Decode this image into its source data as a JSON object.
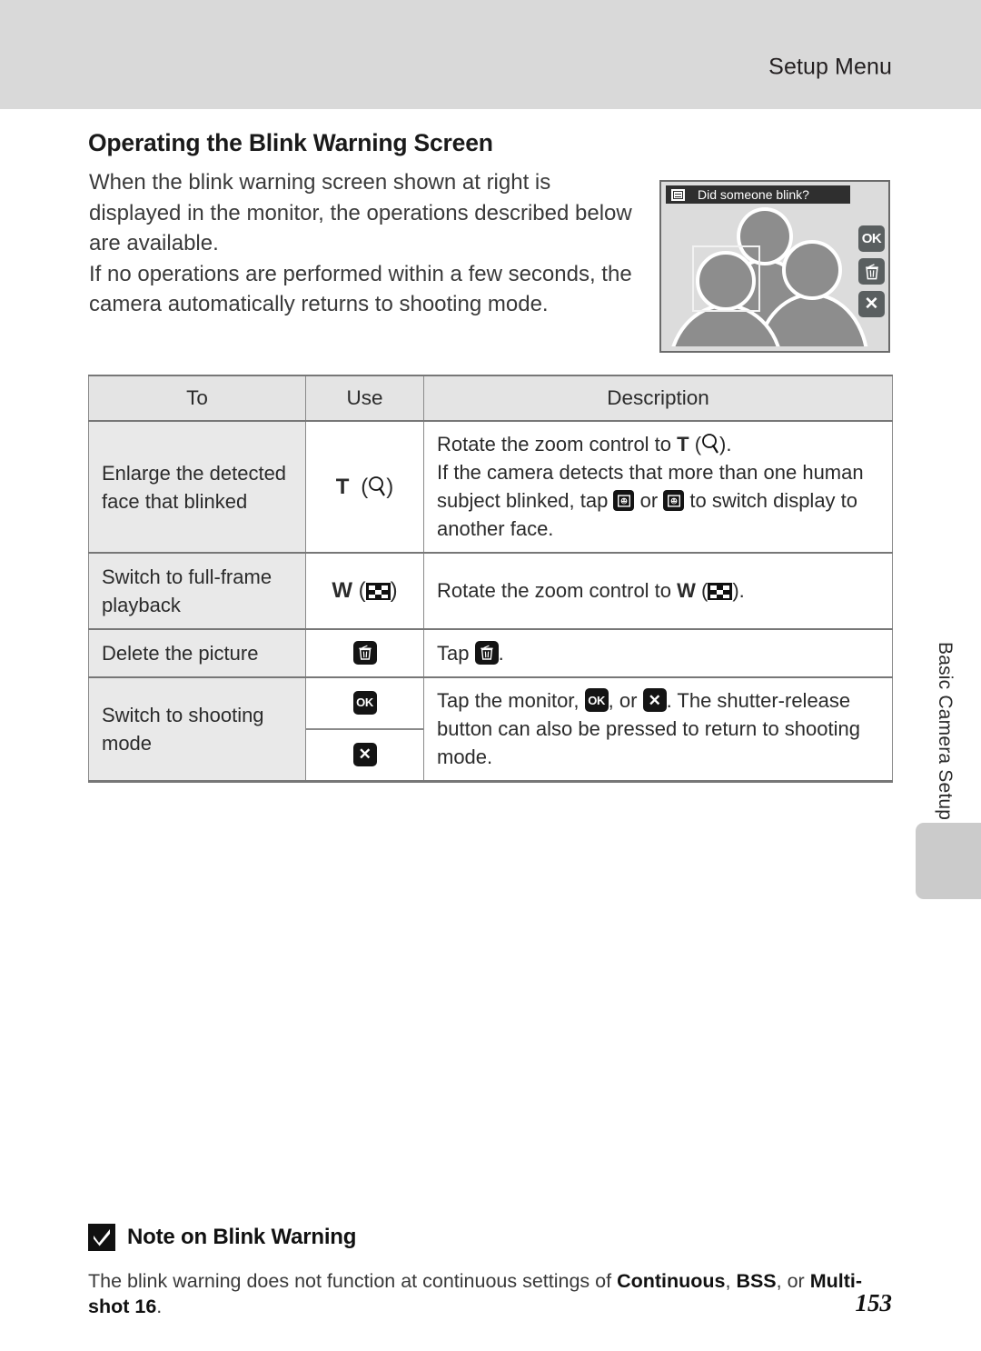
{
  "header": {
    "running_title": "Setup Menu"
  },
  "page": {
    "heading": "Operating the Blink Warning Screen",
    "paragraphs": [
      "When the blink warning screen shown at right is displayed in the monitor, the operations described below are available.",
      "If no operations are performed within a few seconds, the camera automatically returns to shooting mode."
    ],
    "number": "153"
  },
  "monitor": {
    "title": "Did someone blink?",
    "title_icon": "face-detection-icon",
    "buttons": [
      {
        "name": "ok-button",
        "label": "OK"
      },
      {
        "name": "delete-button",
        "label": ""
      },
      {
        "name": "cancel-button",
        "label": "✕"
      }
    ]
  },
  "table": {
    "headers": [
      "To",
      "Use",
      "Description"
    ],
    "rows": [
      {
        "to": "Enlarge the detected face that blinked",
        "use_text": "T",
        "use_paren_icon": "magnifier-icon",
        "desc_lines": [
          "Rotate the zoom control to T (⚲).",
          "If the camera detects that more than one human subject blinked, tap ▣ or ▣ to switch display to another face."
        ],
        "desc_part1_a": "Rotate the zoom control to ",
        "desc_part1_b": "T",
        "desc_part1_c": ").",
        "desc_part2_a": "If the camera detects that more than one human subject blinked, tap ",
        "desc_part2_b": " or ",
        "desc_part2_c": " to switch display to another face."
      },
      {
        "to": "Switch to full-frame playback",
        "use_text": "W",
        "use_paren_icon": "wide-thumbnail-icon",
        "desc_a": "Rotate the zoom control to ",
        "desc_b": "W",
        "desc_c": ")."
      },
      {
        "to": "Delete the picture",
        "use_icon": "trash-icon",
        "desc_a": "Tap ",
        "desc_b": "."
      },
      {
        "to": "Switch to shooting mode",
        "use_icon_1": "ok-icon",
        "use_icon_2": "close-icon",
        "desc_a": "Tap the monitor, ",
        "desc_b": ", or ",
        "desc_c": ". The shutter-release button can also be pressed to return to shooting mode."
      }
    ]
  },
  "side_tab": {
    "label": "Basic Camera Setup"
  },
  "note": {
    "badge_icon": "checkmark-badge-icon",
    "title": "Note on Blink Warning",
    "text_a": "The blink warning does not function at continuous settings of ",
    "bold_1": "Continuous",
    "text_b": ", ",
    "bold_2": "BSS",
    "text_c": ", or ",
    "bold_3": "Multi-shot 16",
    "text_d": "."
  },
  "colors": {
    "header_band": "#d9d9d9",
    "table_header": "#e4e4e4",
    "table_first_col": "#e9e9e9",
    "monitor_bg": "#dcdcdc",
    "figure_fill": "#8d8d8d",
    "monitor_button": "#5a5f60",
    "side_tab": "#cbcbcb"
  }
}
